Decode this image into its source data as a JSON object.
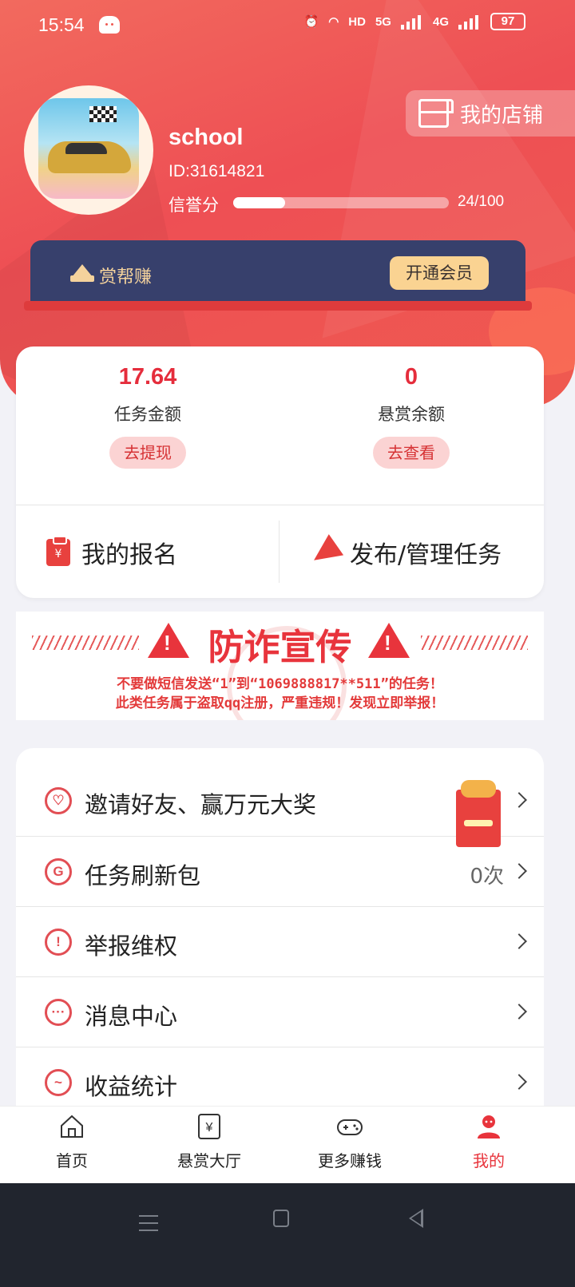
{
  "status_bar": {
    "time": "15:54",
    "battery": "97",
    "hd": "HD",
    "sig1": "5G",
    "sig2": "4G"
  },
  "profile": {
    "name": "school",
    "id": "ID:31614821",
    "credit_label": "信誉分",
    "credit_value": "24/100",
    "credit_fraction": 0.24
  },
  "shop_label": "我的店铺",
  "vip": {
    "title": "赏帮赚",
    "button": "开通会员"
  },
  "balances": [
    {
      "amount": "17.64",
      "label": "任务金额",
      "action": "去提现"
    },
    {
      "amount": "0",
      "label": "悬赏余额",
      "action": "去查看"
    }
  ],
  "actions": {
    "signup": "我的报名",
    "publish": "发布/管理任务"
  },
  "fraud_notice": {
    "title": "防诈宣传",
    "line1": "不要做短信发送“1”到“1069888817**511”的任务！",
    "line2": "此类任务属于盗取qq注册，严重违规！发现立即举报！"
  },
  "menu": [
    {
      "label": "邀请好友、赢万元大奖",
      "value": "",
      "icon": "heart-icon"
    },
    {
      "label": "任务刷新包",
      "value": "0次",
      "icon": "refresh-icon"
    },
    {
      "label": "举报维权",
      "value": "",
      "icon": "warning-icon"
    },
    {
      "label": "消息中心",
      "value": "",
      "icon": "message-icon"
    },
    {
      "label": "收益统计",
      "value": "",
      "icon": "chart-icon"
    }
  ],
  "tabs": [
    {
      "label": "首页",
      "icon": "home-icon"
    },
    {
      "label": "悬赏大厅",
      "icon": "yuan-icon"
    },
    {
      "label": "更多赚钱",
      "icon": "gamepad-icon"
    },
    {
      "label": "我的",
      "icon": "user-icon",
      "active": true
    }
  ],
  "colors": {
    "brand_red": "#e8343c",
    "vip_navy": "#37406c",
    "vip_gold": "#fad392"
  }
}
